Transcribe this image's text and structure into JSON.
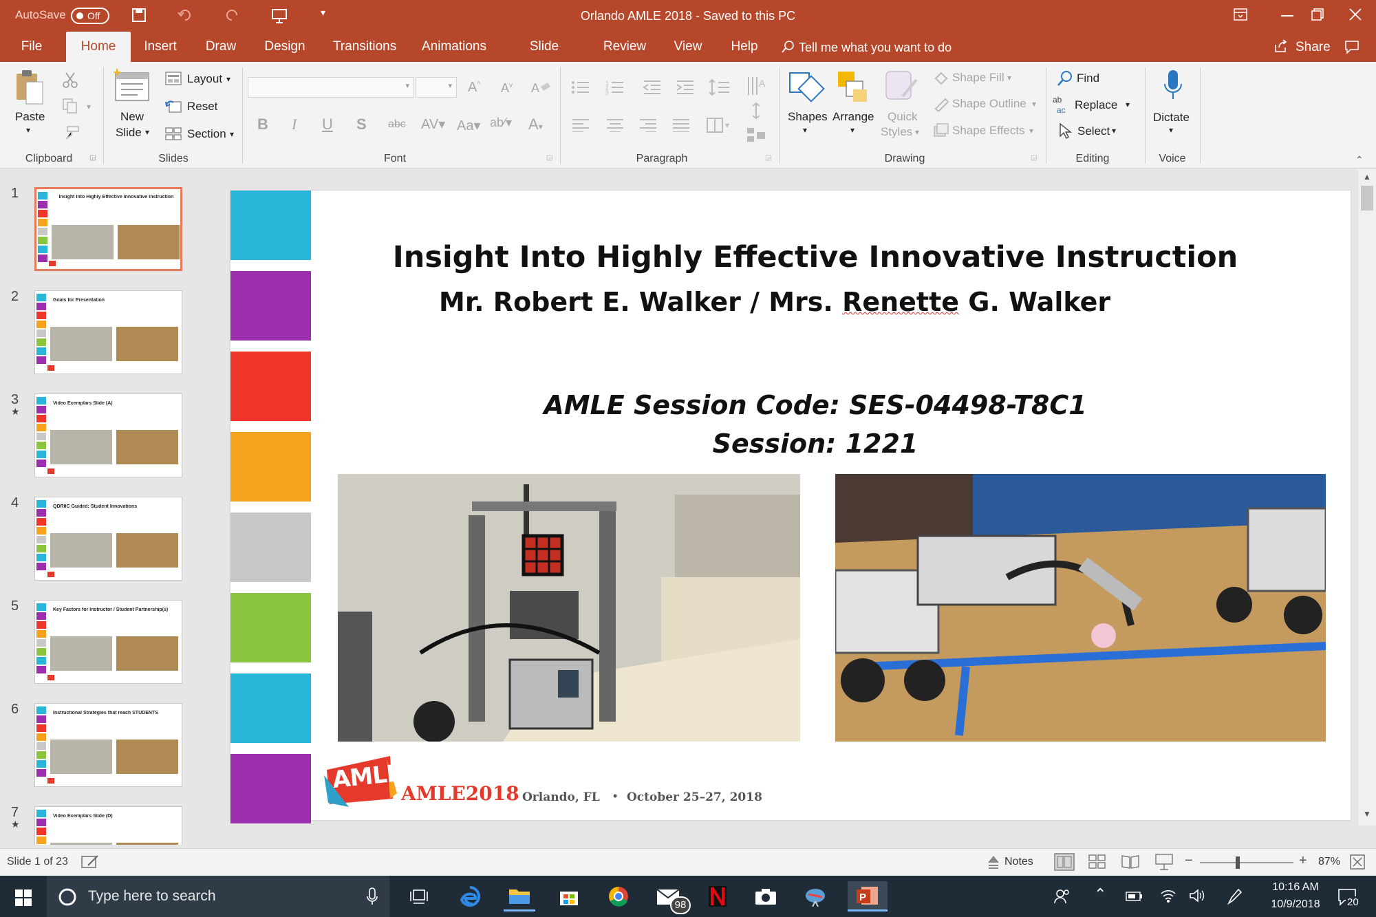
{
  "titlebar": {
    "autosave": "AutoSave",
    "autosave_state": "Off",
    "title": "Orlando AMLE 2018  -  Saved to this PC"
  },
  "tabs": [
    "File",
    "Home",
    "Insert",
    "Draw",
    "Design",
    "Transitions",
    "Animations",
    "Slide Show",
    "Review",
    "View",
    "Help"
  ],
  "tell_me": "Tell me what you want to do",
  "share": "Share",
  "ribbon": {
    "clipboard": {
      "paste": "Paste",
      "label": "Clipboard"
    },
    "slides": {
      "new_slide_1": "New",
      "new_slide_2": "Slide",
      "layout": "Layout",
      "reset": "Reset",
      "section": "Section",
      "label": "Slides"
    },
    "font": {
      "label": "Font"
    },
    "paragraph": {
      "label": "Paragraph"
    },
    "drawing": {
      "shapes": "Shapes",
      "arrange": "Arrange",
      "quick_styles_1": "Quick",
      "quick_styles_2": "Styles",
      "shape_fill": "Shape Fill",
      "shape_outline": "Shape Outline",
      "shape_effects": "Shape Effects",
      "label": "Drawing"
    },
    "editing": {
      "find": "Find",
      "replace": "Replace",
      "select": "Select",
      "label": "Editing"
    },
    "voice": {
      "dictate": "Dictate",
      "label": "Voice"
    }
  },
  "thumbnails": [
    {
      "num": "1",
      "title": "Insight Into Highly Effective Innovative Instruction",
      "starred": false
    },
    {
      "num": "2",
      "title": "Goals for Presentation",
      "starred": false
    },
    {
      "num": "3",
      "title": "Video Exemplars Slide (A)",
      "starred": true
    },
    {
      "num": "4",
      "title": "QDRIIC Guided: Student Innovations",
      "starred": false
    },
    {
      "num": "5",
      "title": "Key Factors for Instructor / Student Partnership(s)",
      "starred": false
    },
    {
      "num": "6",
      "title": "Instructional Strategies that reach STUDENTS",
      "starred": false
    },
    {
      "num": "7",
      "title": "Video Exemplars Slide (D)",
      "starred": true
    }
  ],
  "slide": {
    "title": "Insight Into Highly Effective Innovative Instruction",
    "presenters_1": "Mr. Robert E. Walker / Mrs. ",
    "presenters_2": "Renette",
    "presenters_3": " G. Walker",
    "session_code": "AMLE Session Code: SES-04498-T8C1",
    "session": "Session: 1221",
    "logo_text": "AMLE",
    "event": "AMLE2018",
    "location": "Orlando, FL",
    "bullet": "•",
    "dates": "October 25–27, 2018",
    "bar_colors": [
      "#29b6d9",
      "#9b2fae",
      "#f0362b",
      "#f5a21d",
      "#c8c8c8",
      "#8bc53f",
      "#29b6d9",
      "#9b2fae"
    ]
  },
  "status": {
    "slide_of": "Slide 1 of 23",
    "notes": "Notes",
    "zoom": "87%"
  },
  "taskbar": {
    "search": "Type here to search",
    "mail_badge": "98",
    "time": "10:16 AM",
    "date": "10/9/2018",
    "notif": "20"
  }
}
